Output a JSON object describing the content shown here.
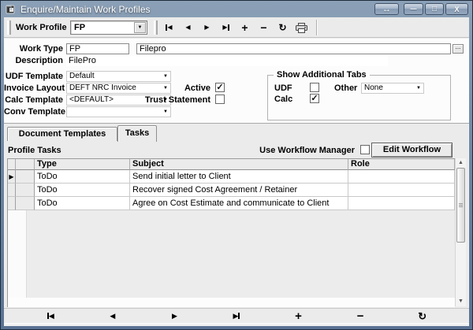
{
  "window": {
    "title": "Enquire/Maintain Work Profiles",
    "controls": {
      "restore": "↔",
      "minimize": "—",
      "maximize": "□",
      "close": "X"
    }
  },
  "glyphs": {
    "check": "✓",
    "left_triangle": "◀",
    "right_triangle": "▶",
    "plus": "+",
    "minus": "−",
    "refresh": "↻",
    "up_arrow": "▲",
    "down_arrow": "▼",
    "dropdown_arrow": "▼",
    "row_marker": "▶",
    "browse": "..."
  },
  "toolbar": {
    "work_profile_label": "Work Profile",
    "work_profile_value": "FP"
  },
  "form": {
    "work_type_label": "Work Type",
    "work_type_code": "FP",
    "work_type_name": "Filepro",
    "description_label": "Description",
    "description_value": "FilePro",
    "udf_template_label": "UDF Template",
    "udf_template_value": "Default",
    "invoice_layout_label": "Invoice Layout",
    "invoice_layout_value": "DEFT NRC Invoice",
    "calc_template_label": "Calc Template",
    "calc_template_value": "<DEFAULT>",
    "conv_template_label": "Conv Template",
    "conv_template_value": "",
    "active_label": "Active",
    "active_checked": true,
    "trust_statement_label": "Trust Statement",
    "trust_statement_checked": false,
    "group": {
      "title": "Show Additional Tabs",
      "udf_label": "UDF",
      "udf_checked": false,
      "calc_label": "Calc",
      "calc_checked": true,
      "other_label": "Other",
      "other_value": "None"
    }
  },
  "tabs": {
    "document_templates": "Document Templates",
    "tasks": "Tasks"
  },
  "tasks_panel": {
    "title": "Profile Tasks",
    "use_workflow_manager_label": "Use Workflow Manager",
    "use_workflow_manager_checked": false,
    "edit_workflow_button": "Edit Workflow",
    "table": {
      "headers": {
        "type": "Type",
        "subject": "Subject",
        "role": "Role"
      },
      "rows": [
        {
          "selected": true,
          "type": "ToDo",
          "subject": "Send initial letter to Client",
          "role": ""
        },
        {
          "selected": false,
          "type": "ToDo",
          "subject": "Recover signed Cost Agreement / Retainer",
          "role": ""
        },
        {
          "selected": false,
          "type": "ToDo",
          "subject": "Agree on Cost Estimate and communicate to Client",
          "role": ""
        }
      ]
    }
  }
}
